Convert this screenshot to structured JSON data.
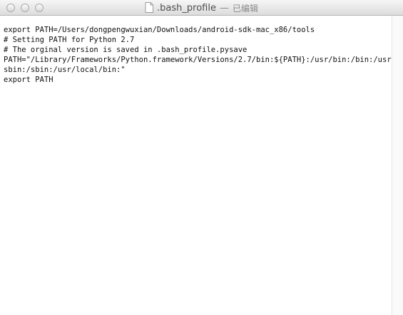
{
  "window": {
    "title": ".bash_profile",
    "separator": "—",
    "status": "已编辑"
  },
  "icons": {
    "document": "document-icon",
    "close": "close-button",
    "minimize": "minimize-button",
    "zoom": "zoom-button"
  },
  "editor": {
    "lines": [
      "export PATH=/Users/dongpengwuxian/Downloads/android-sdk-mac_x86/tools",
      "# Setting PATH for Python 2.7",
      "# The orginal version is saved in .bash_profile.pysave",
      "PATH=\"/Library/Frameworks/Python.framework/Versions/2.7/bin:${PATH}:/usr/bin:/bin:/usr/",
      "sbin:/sbin:/usr/local/bin:\"",
      "export PATH"
    ]
  }
}
